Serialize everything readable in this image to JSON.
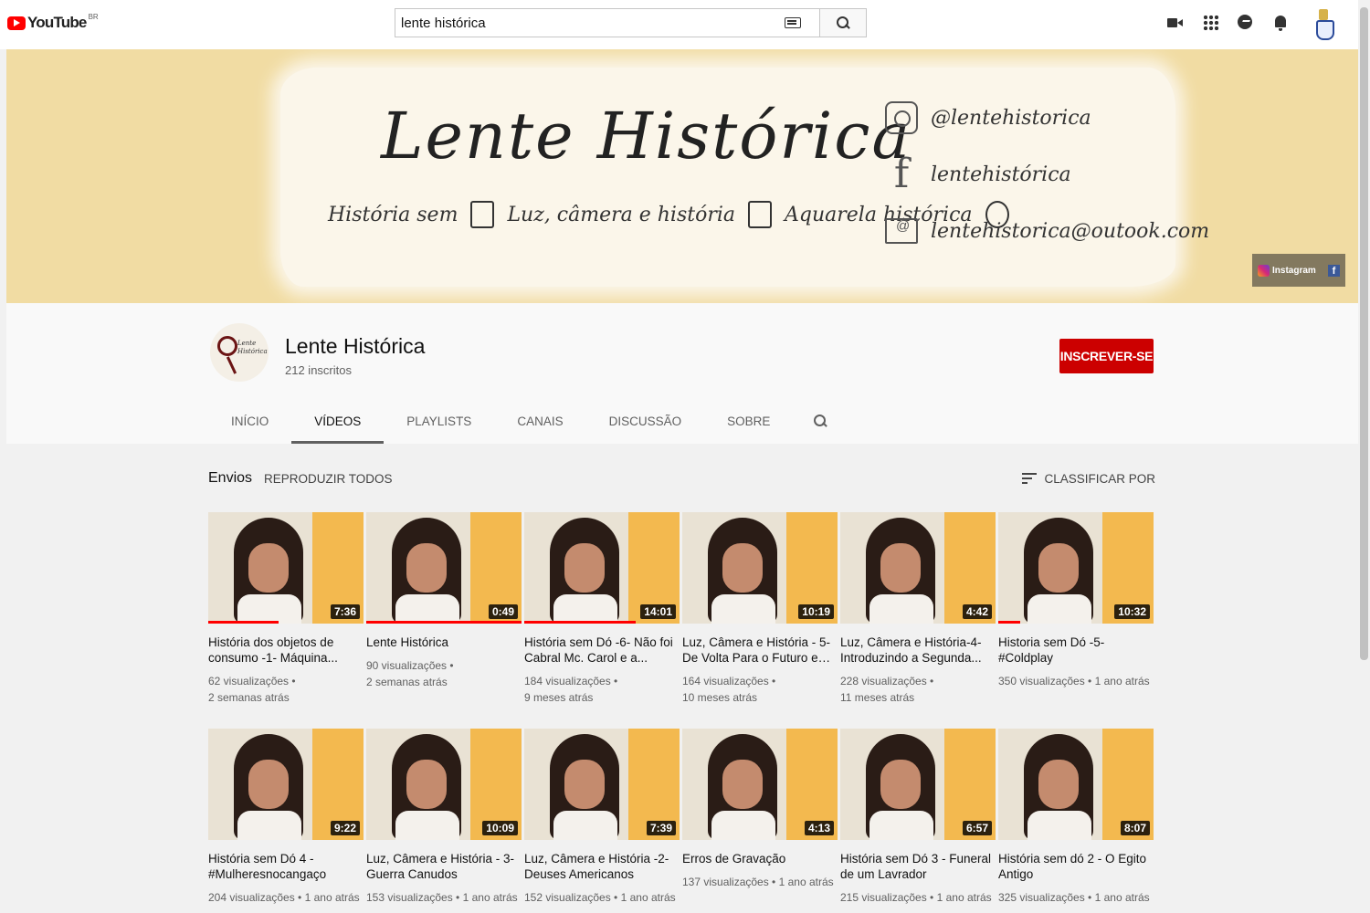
{
  "topbar": {
    "logo_text": "YouTube",
    "country": "BR",
    "search_value": "lente histórica",
    "icons": [
      "camera-icon",
      "apps-icon",
      "messages-icon",
      "bell-icon"
    ]
  },
  "banner": {
    "title": "Lente Histórica",
    "subtitle_1": "História sem",
    "subtitle_2": "Luz, câmera e história",
    "subtitle_3": "Aquarela histórica",
    "instagram": "@lentehistorica",
    "facebook": "lentehistórica",
    "email": "lentehistorica@outook.com",
    "links_label": "Instagram",
    "background_color": "#f1dca3"
  },
  "channel": {
    "avatar_text": "Lente Histórica",
    "name": "Lente Histórica",
    "subscribers": "212 inscritos",
    "subscribe_label": "INSCREVER-SE",
    "subscribe_color": "#cc0000",
    "tabs": [
      {
        "label": "INÍCIO",
        "active": false
      },
      {
        "label": "VÍDEOS",
        "active": true
      },
      {
        "label": "PLAYLISTS",
        "active": false
      },
      {
        "label": "CANAIS",
        "active": false
      },
      {
        "label": "DISCUSSÃO",
        "active": false
      },
      {
        "label": "SOBRE",
        "active": false
      }
    ]
  },
  "shelf": {
    "title": "Envios",
    "play_all": "REPRODUZIR TODOS",
    "sort_label": "CLASSIFICAR POR"
  },
  "videos_row1": [
    {
      "title": "História dos objetos de consumo -1- Máquina...",
      "duration": "7:36",
      "views": "62 visualizações •",
      "age": "2 semanas atrás",
      "watched": 0.45
    },
    {
      "title": "Lente Histórica",
      "duration": "0:49",
      "views": "90 visualizações •",
      "age": "2 semanas atrás",
      "watched": 1.0
    },
    {
      "title": "História sem Dó -6- Não foi Cabral Mc. Carol e a...",
      "duration": "14:01",
      "views": "184 visualizações •",
      "age": "9 meses atrás",
      "watched": 0.72
    },
    {
      "title": "Luz, Câmera e História - 5- De Volta Para o Futuro e a...",
      "duration": "10:19",
      "views": "164 visualizações •",
      "age": "10 meses atrás",
      "watched": 0
    },
    {
      "title": "Luz, Câmera e História-4- Introduzindo a Segunda...",
      "duration": "4:42",
      "views": "228 visualizações •",
      "age": "11 meses atrás",
      "watched": 0
    },
    {
      "title": "Historia sem Dó -5- #Coldplay",
      "duration": "10:32",
      "views": "350 visualizações • 1 ano atrás",
      "age": "",
      "watched": 0.14
    }
  ],
  "videos_row2": [
    {
      "title": "História sem Dó 4 - #Mulheresnocangaço",
      "duration": "9:22",
      "views": "204 visualizações • 1 ano atrás"
    },
    {
      "title": "Luz, Câmera e História - 3- Guerra Canudos",
      "duration": "10:09",
      "views": "153 visualizações • 1 ano atrás"
    },
    {
      "title": "Luz, Câmera e História -2- Deuses Americanos",
      "duration": "7:39",
      "views": "152 visualizações • 1 ano atrás"
    },
    {
      "title": "Erros de Gravação",
      "duration": "4:13",
      "views": "137 visualizações • 1 ano atrás"
    },
    {
      "title": "História sem Dó 3 - Funeral de um Lavrador",
      "duration": "6:57",
      "views": "215 visualizações • 1 ano atrás"
    },
    {
      "title": "História sem dó 2 - O Egito Antigo",
      "duration": "8:07",
      "views": "325 visualizações • 1 ano atrás"
    }
  ]
}
